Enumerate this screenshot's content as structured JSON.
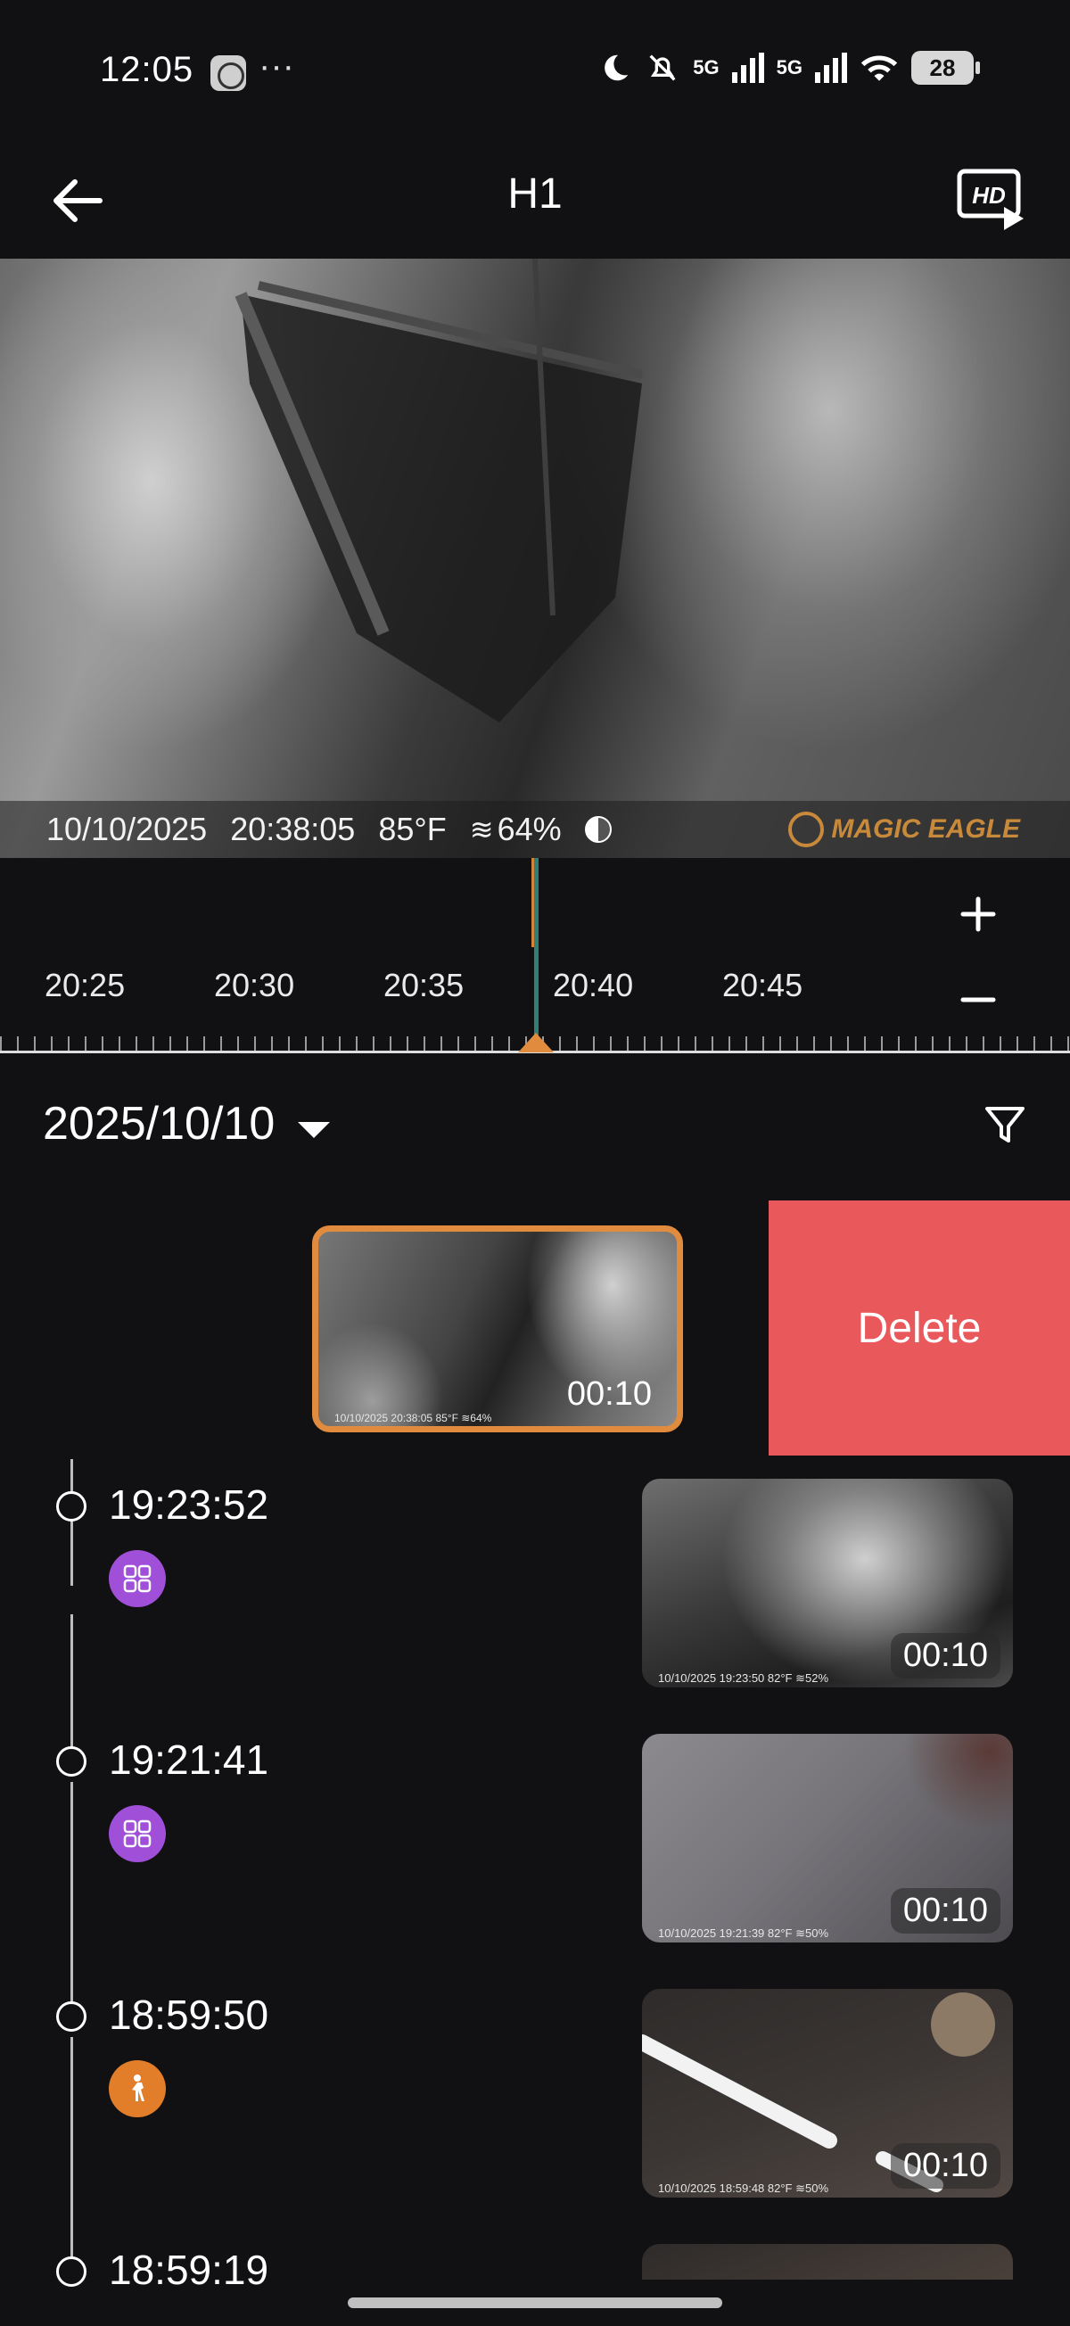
{
  "status_bar": {
    "time": "12:05",
    "dots": "···",
    "signal_1": "5G",
    "signal_2": "5G",
    "battery": "28"
  },
  "header": {
    "title": "H1",
    "back_icon": "arrow-left-icon",
    "hd_icon": "hd-play-icon"
  },
  "video": {
    "date": "10/10/2025",
    "time": "20:38:05",
    "temperature": "85°F",
    "humidity": "64%",
    "watermark": "MAGIC EAGLE"
  },
  "timeline": {
    "labels": [
      "20:25",
      "20:30",
      "20:35",
      "20:40",
      "20:45"
    ],
    "zoom_in": "+",
    "zoom_out": "−"
  },
  "date_filter": {
    "date": "2025/10/10",
    "filter_icon": "filter-icon"
  },
  "swiped_item": {
    "duration": "00:10",
    "caption": "10/10/2025  20:38:05   85°F  ≋64%",
    "delete_label": "Delete"
  },
  "events": [
    {
      "time": "19:23:52",
      "badge": "grid-icon",
      "badge_color": "#a04fd8",
      "duration": "00:10",
      "caption": "10/10/2025  19:23:50   82°F  ≋52%"
    },
    {
      "time": "19:21:41",
      "badge": "grid-icon",
      "badge_color": "#a04fd8",
      "duration": "00:10",
      "caption": "10/10/2025  19:21:39   82°F  ≋50%"
    },
    {
      "time": "18:59:50",
      "badge": "person-icon",
      "badge_color": "#e27d2a",
      "duration": "00:10",
      "caption": "10/10/2025  18:59:48   82°F  ≋50%"
    },
    {
      "time": "18:59:19"
    }
  ],
  "colors": {
    "accent": "#e08b3e",
    "delete": "#e9585a",
    "background": "#111113"
  }
}
